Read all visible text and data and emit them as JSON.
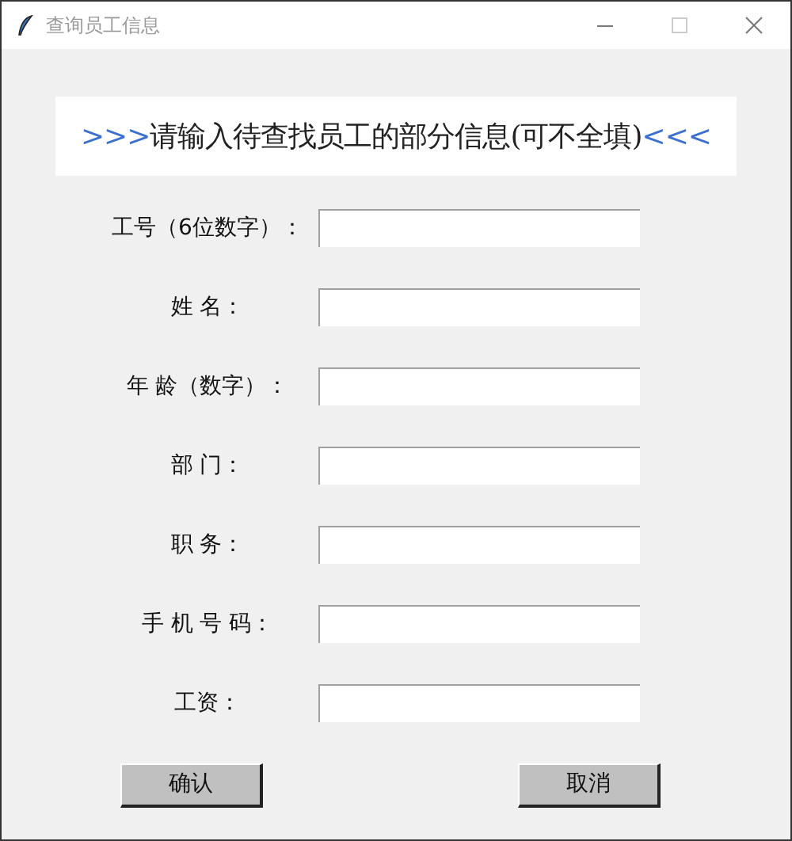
{
  "window": {
    "title": "查询员工信息"
  },
  "heading": {
    "prefix": ">>>",
    "text": "请输入待查找员工的部分信息(可不全填)",
    "suffix": "<<<"
  },
  "fields": [
    {
      "label": "工号（6位数字）："
    },
    {
      "label": "姓 名："
    },
    {
      "label": "年 龄（数字）："
    },
    {
      "label": "部 门："
    },
    {
      "label": "职 务："
    },
    {
      "label": "手 机 号 码："
    },
    {
      "label": "工资："
    }
  ],
  "buttons": [
    "确认",
    "取消"
  ]
}
